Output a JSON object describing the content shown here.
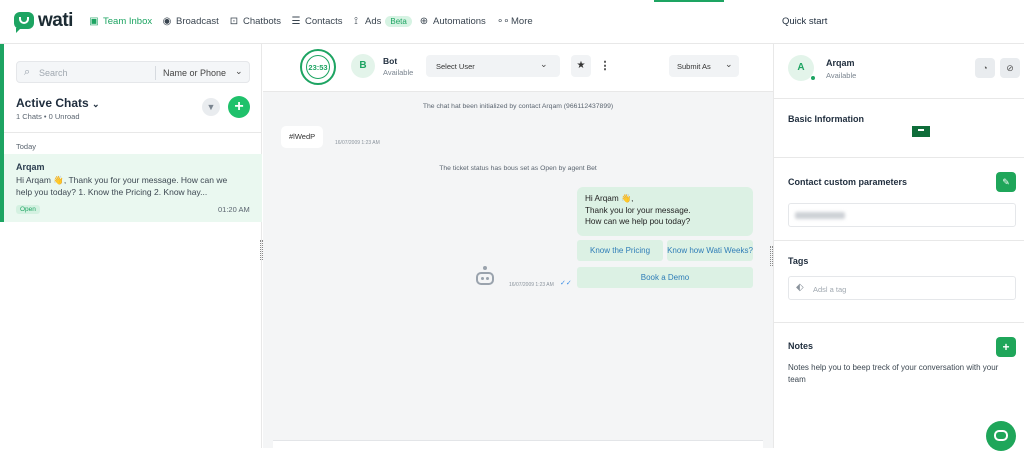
{
  "brand": {
    "name": "wati",
    "color": "#1da462"
  },
  "nav": {
    "items": [
      {
        "label": "Team Inbox",
        "icon": "inbox-icon",
        "active": true
      },
      {
        "label": "Broadcast",
        "icon": "broadcast-icon"
      },
      {
        "label": "Chatbots",
        "icon": "chatbot-icon"
      },
      {
        "label": "Contacts",
        "icon": "contacts-icon"
      },
      {
        "label": "Ads",
        "icon": "ads-icon",
        "badge": "Beta"
      },
      {
        "label": "Automations",
        "icon": "automations-icon"
      },
      {
        "label": "More",
        "icon": "more-dots-icon"
      }
    ],
    "quick_start": "Quick start"
  },
  "left": {
    "search_placeholder": "Search",
    "search_filter": "Name or Phone",
    "active_chats_title": "Active Chats",
    "active_chats_sub": "1 Chats • 0 Unroad",
    "section_label": "Today",
    "chats": [
      {
        "name": "Arqam",
        "preview": "Hi Arqam 👋, Thank you for your message. How can we help you today? 1. Know the Pricing 2. Know hay...",
        "status": "Open",
        "time": "01:20 AM"
      }
    ]
  },
  "conversation": {
    "timer": "23:53",
    "bot_initial": "B",
    "bot_name": "Bot",
    "bot_status": "Available",
    "select_user": "Select User",
    "submit_as": "Submit As",
    "system_msg_1": "The chat hat been initialized by contact Arqam (966112437899)",
    "tag_message": "#lWedP",
    "tag_time": "16/07/2009 1:23 AM",
    "system_msg_2": "The ticket status has bous set as Open by agent Bet",
    "bot_message_lines": [
      "Hi Arqam 👋,",
      "Thank you lor your message.",
      "How can we help pou today?"
    ],
    "quick_replies": [
      "Know the Pricing",
      "Know how Wati Weeks?",
      "Book a Demo"
    ],
    "bot_message_time": "16/07/2009 1:23 AM"
  },
  "contact": {
    "initial": "A",
    "name": "Arqam",
    "status": "Available",
    "basic_info_title": "Basic Information",
    "custom_params_title": "Contact custom parameters",
    "tags_title": "Tags",
    "tag_placeholder": "Adsl a tag",
    "notes_title": "Notes",
    "notes_help": "Notes help you to beep treck of your conversation with your team"
  }
}
